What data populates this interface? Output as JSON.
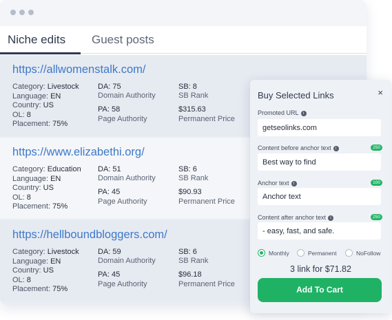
{
  "tabs": [
    {
      "label": "Niche edits",
      "active": true
    },
    {
      "label": "Guest posts",
      "active": false
    }
  ],
  "listings": [
    {
      "url": "https://allwomenstalk.com/",
      "category": "Livestock",
      "language": "EN",
      "country": "US",
      "ol": "8",
      "placement": "75%",
      "da": "75",
      "pa": "58",
      "sb": "8",
      "price": "$315.63"
    },
    {
      "url": "https://www.elizabethi.org/",
      "category": "Education",
      "language": "EN",
      "country": "US",
      "ol": "8",
      "placement": "75%",
      "da": "51",
      "pa": "45",
      "sb": "6",
      "price": "$90.93"
    },
    {
      "url": "https://hellboundbloggers.com/",
      "category": "Livestock",
      "language": "EN",
      "country": "US",
      "ol": "8",
      "placement": "75%",
      "da": "59",
      "pa": "45",
      "sb": "6",
      "price": "$96.18"
    }
  ],
  "labels": {
    "category": "Category:",
    "language": "Language:",
    "country": "Country:",
    "ol": "OL:",
    "placement": "Placement:",
    "da_prefix": "DA:",
    "pa_prefix": "PA:",
    "sb_prefix": "SB:",
    "domain_authority": "Domain Authority",
    "page_authority": "Page Authority",
    "sb_rank": "SB Rank",
    "permanent_price": "Permanent Price"
  },
  "panel": {
    "title": "Buy Selected Links",
    "close": "×",
    "promoted_url_label": "Promoted URL",
    "promoted_url_value": "getseolinks.com",
    "before_label": "Content before anchor text",
    "before_count": "250",
    "before_value": "Best way to find",
    "anchor_label": "Anchor text",
    "anchor_count": "100",
    "anchor_value": "Anchor text",
    "after_label": "Content after anchor text",
    "after_count": "250",
    "after_value": "- easy, fast, and safe.",
    "options": [
      {
        "label": "Monthly",
        "selected": true
      },
      {
        "label": "Permanent",
        "selected": false
      },
      {
        "label": "NoFollow",
        "selected": false
      }
    ],
    "total": "3 link for $71.82",
    "button": "Add To Cart"
  },
  "colors": {
    "accent": "#1fb264",
    "link": "#3d79c9"
  }
}
